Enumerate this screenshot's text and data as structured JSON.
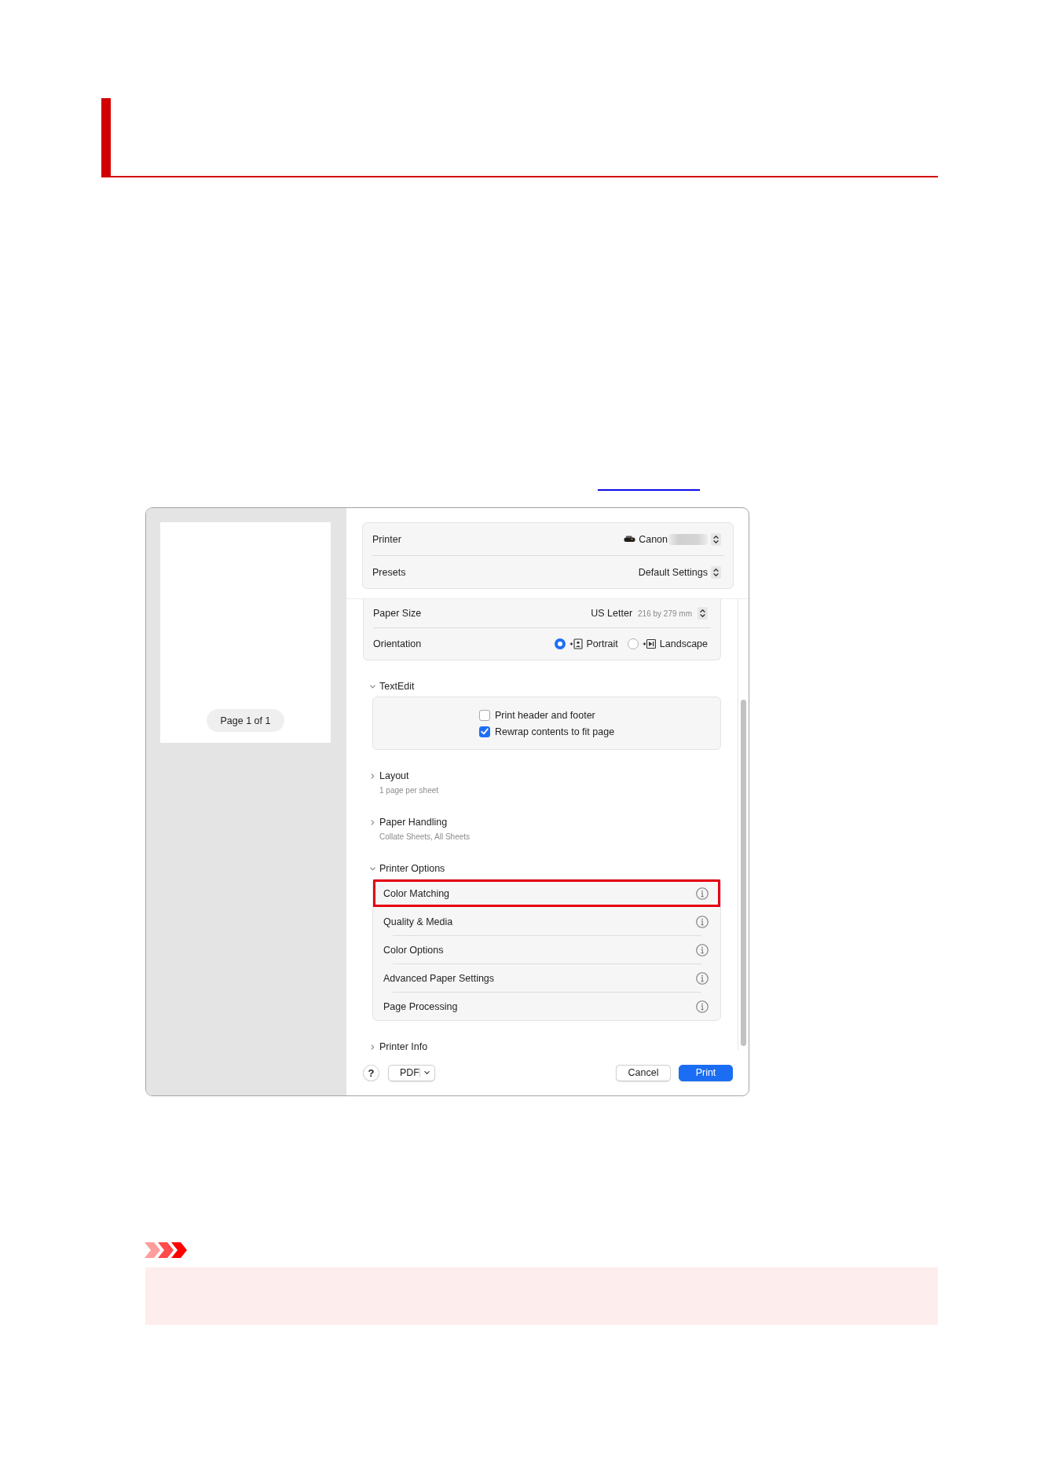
{
  "print_dialog": {
    "preview": {
      "page_label": "Page 1 of 1"
    },
    "header_rows": [
      {
        "kind": "printer",
        "label": "Printer",
        "value": "Canon"
      },
      {
        "kind": "plain",
        "label": "Presets",
        "value": "Default Settings"
      }
    ],
    "paper_size": {
      "label": "Paper Size",
      "value": "US Letter",
      "detail": "216 by 279 mm"
    },
    "orientation": {
      "label": "Orientation",
      "options": [
        {
          "label": "Portrait",
          "selected": true
        },
        {
          "label": "Landscape",
          "selected": false
        }
      ]
    },
    "sections": [
      {
        "kind": "checkboxes",
        "title": "TextEdit",
        "expanded": true,
        "items": [
          {
            "label": "Print header and footer",
            "checked": false
          },
          {
            "label": "Rewrap contents to fit page",
            "checked": true
          }
        ]
      },
      {
        "kind": "summary",
        "title": "Layout",
        "expanded": false,
        "summary": "1 page per sheet"
      },
      {
        "kind": "summary",
        "title": "Paper Handling",
        "expanded": false,
        "summary": "Collate Sheets, All Sheets"
      },
      {
        "kind": "options",
        "title": "Printer Options",
        "expanded": true,
        "items": [
          {
            "label": "Color Matching",
            "highlighted": true
          },
          {
            "label": "Quality & Media",
            "highlighted": false
          },
          {
            "label": "Color Options",
            "highlighted": false
          },
          {
            "label": "Advanced Paper Settings",
            "highlighted": false
          },
          {
            "label": "Page Processing",
            "highlighted": false
          }
        ]
      },
      {
        "kind": "plain",
        "title": "Printer Info",
        "expanded": false
      }
    ],
    "buttons": [
      {
        "kind": "help",
        "label": "?"
      },
      {
        "kind": "menu",
        "label": "PDF"
      },
      {
        "kind": "cancel",
        "label": "Cancel"
      },
      {
        "kind": "print",
        "label": "Print"
      }
    ]
  }
}
